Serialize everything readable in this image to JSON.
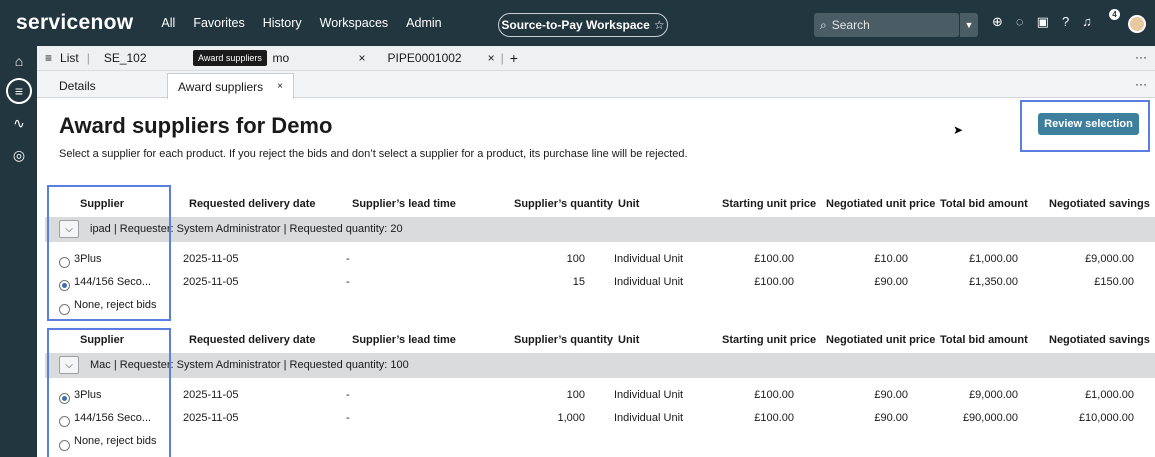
{
  "nav": {
    "logo": "servicenow",
    "items": [
      "All",
      "Favorites",
      "History",
      "Workspaces",
      "Admin"
    ],
    "workspace": "Source-to-Pay Workspace",
    "search_placeholder": "Search",
    "notification_count": "4"
  },
  "tabs": {
    "list": "List",
    "t1": "SE_102",
    "t2_partial": "mo",
    "t3": "PIPE0001002",
    "tooltip": "Award suppliers"
  },
  "subtabs": {
    "details": "Details",
    "award": "Award suppliers"
  },
  "page": {
    "title": "Award suppliers for Demo",
    "description": "Select a supplier for each product. If you reject the bids and don’t select a supplier for a product, its purchase line will be rejected.",
    "review_button": "Review selection"
  },
  "columns": [
    "Supplier",
    "Requested delivery date",
    "Supplier’s lead time",
    "Supplier’s quantity",
    "Unit",
    "Starting unit price",
    "Negotiated unit price",
    "Total bid amount",
    "Negotiated savings"
  ],
  "groups": [
    {
      "info": "ipad  | Requester: System Administrator  | Requested quantity: 20",
      "rows": [
        {
          "supplier": "3Plus",
          "date": "2025-11-05",
          "lead": "-",
          "qty": "100",
          "unit": "Individual Unit",
          "start": "£100.00",
          "neg": "£10.00",
          "total": "£1,000.00",
          "savings": "£9,000.00",
          "selected": false
        },
        {
          "supplier": "144/156 Seco...",
          "date": "2025-11-05",
          "lead": "-",
          "qty": "15",
          "unit": "Individual Unit",
          "start": "£100.00",
          "neg": "£90.00",
          "total": "£1,350.00",
          "savings": "£150.00",
          "selected": true
        }
      ],
      "reject": "None, reject bids"
    },
    {
      "info": "Mac  | Requester: System Administrator  | Requested quantity: 100",
      "rows": [
        {
          "supplier": "3Plus",
          "date": "2025-11-05",
          "lead": "-",
          "qty": "100",
          "unit": "Individual Unit",
          "start": "£100.00",
          "neg": "£90.00",
          "total": "£9,000.00",
          "savings": "£1,000.00",
          "selected": true
        },
        {
          "supplier": "144/156 Seco...",
          "date": "2025-11-05",
          "lead": "-",
          "qty": "1,000",
          "unit": "Individual Unit",
          "start": "£100.00",
          "neg": "£90.00",
          "total": "£90,000.00",
          "savings": "£10,000.00",
          "selected": false
        }
      ],
      "reject": "None, reject bids"
    }
  ]
}
